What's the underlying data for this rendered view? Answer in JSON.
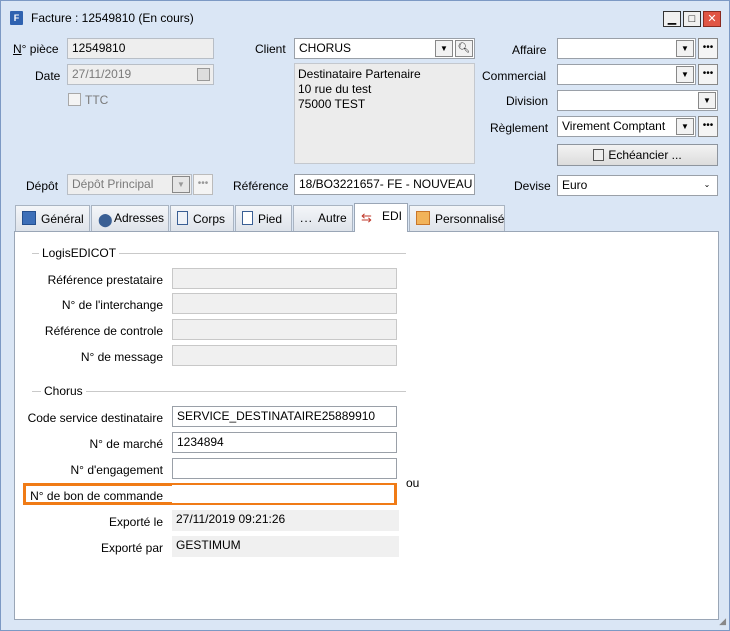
{
  "window": {
    "title": "Facture : 12549810 (En cours)",
    "minimize": "▁",
    "maximize": "□",
    "close": "✕"
  },
  "header": {
    "piece_label_u": "N",
    "piece_label_rest": "° pièce",
    "piece_value": "12549810",
    "date_label": "Date",
    "date_value": "27/11/2019",
    "ttc_label": "TTC",
    "client_label": "Client",
    "client_value": "CHORUS",
    "address_line1": "Destinataire Partenaire",
    "address_line2": "10 rue du test",
    "address_line3": "75000 TEST",
    "affaire_label": "Affaire",
    "affaire_value": "",
    "commercial_label": "Commercial",
    "commercial_value": "",
    "division_label": "Division",
    "division_value": "",
    "reglement_label": "Règlement",
    "reglement_value": "Virement Comptant",
    "echeancier_label": "Echéancier ...",
    "depot_label": "Dépôt",
    "depot_value": "Dépôt Principal",
    "reference_label": "Référence",
    "reference_value": "18/BO3221657- FE - NOUVEAU H",
    "devise_label": "Devise",
    "devise_value": "Euro"
  },
  "tabs": [
    {
      "label": "Général",
      "icon": "general-icon"
    },
    {
      "label": "Adresses",
      "icon": "location-pin-icon"
    },
    {
      "label": "Corps",
      "icon": "document-icon"
    },
    {
      "label": "Pied",
      "icon": "page-icon"
    },
    {
      "label": "Autre",
      "icon": "ellipsis-icon"
    },
    {
      "label": "EDI",
      "icon": "exchange-arrows-icon"
    },
    {
      "label": "Personnalisé",
      "icon": "custom-icon"
    }
  ],
  "edi": {
    "logis_group": "LogisEDICOT",
    "ref_prestataire_label": "Référence prestataire",
    "ref_prestataire_value": "",
    "interchange_label": "N° de l'interchange",
    "interchange_value": "",
    "ref_controle_label": "Référence de controle",
    "ref_controle_value": "",
    "message_label": "N° de message",
    "message_value": "",
    "chorus_group": "Chorus",
    "code_service_label": "Code service destinataire",
    "code_service_value": "SERVICE_DESTINATAIRE25889910",
    "marche_label": "N° de marché",
    "marche_value": "1234894",
    "engagement_label": "N° d'engagement",
    "engagement_value": "",
    "ou_label": "ou",
    "bon_commande_label": "N° de bon de commande",
    "bon_commande_value": "",
    "exporte_le_label": "Exporté le",
    "exporte_le_value": "27/11/2019 09:21:26",
    "exporte_par_label": "Exporté par",
    "exporte_par_value": "GESTIMUM"
  },
  "colors": {
    "highlight": "#f07b16",
    "window_bg": "#dae6f5"
  }
}
